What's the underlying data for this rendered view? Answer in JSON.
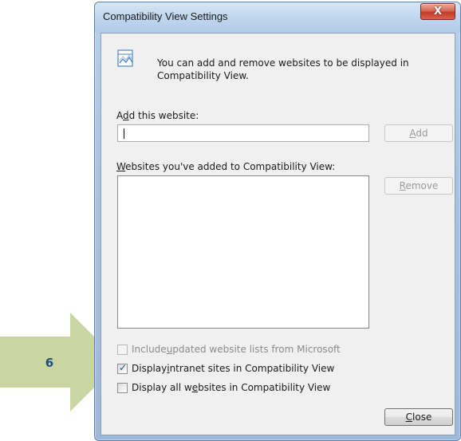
{
  "dialog": {
    "title": "Compatibility View Settings",
    "close_glyph": "X"
  },
  "info": {
    "text": "You can add and remove websites to be displayed in Compatibility View.",
    "icon": "website-compat-icon"
  },
  "add_section": {
    "label_pre": "A",
    "label_accel": "d",
    "label_post": "d this website:",
    "input_value": "",
    "add_button_pre": "",
    "add_button_accel": "A",
    "add_button_post": "dd"
  },
  "list_section": {
    "label_pre": "",
    "label_accel": "W",
    "label_post": "ebsites you've added to Compatibility View:",
    "items": [],
    "remove_button_pre": "",
    "remove_button_accel": "R",
    "remove_button_post": "emove"
  },
  "options": [
    {
      "pre": "Include ",
      "accel": "u",
      "post": "pdated website lists from Microsoft",
      "checked": false,
      "disabled": true
    },
    {
      "pre": "Display ",
      "accel": "i",
      "post": "ntranet sites in Compatibility View",
      "checked": true,
      "disabled": false
    },
    {
      "pre": "Display all w",
      "accel": "e",
      "post": "bsites in Compatibility View",
      "checked": false,
      "disabled": false
    }
  ],
  "footer": {
    "close_pre": "",
    "close_accel": "C",
    "close_post": "lose"
  },
  "callout": {
    "label": "6",
    "color": "#c9d6a3"
  }
}
